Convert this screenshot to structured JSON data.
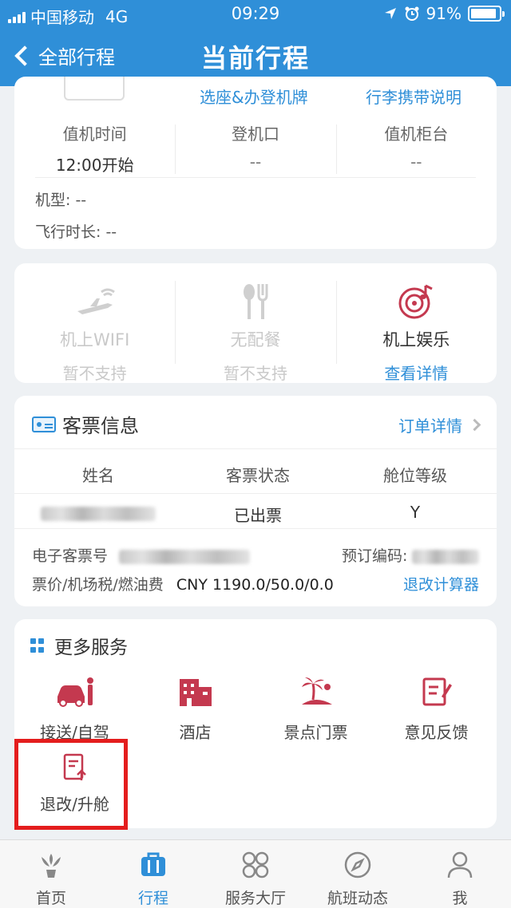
{
  "status_bar": {
    "carrier": "中国移动",
    "network": "4G",
    "time": "09:29",
    "battery_percent": "91%",
    "battery_level": 0.91
  },
  "nav": {
    "back_label": "全部行程",
    "title": "当前行程"
  },
  "flight_card": {
    "links": [
      "选座&办登机牌",
      "行李携带说明"
    ],
    "columns": [
      {
        "label": "值机时间",
        "value": "12:00开始"
      },
      {
        "label": "登机口",
        "value": "--"
      },
      {
        "label": "值机柜台",
        "value": "--"
      }
    ],
    "aircraft": "机型: --",
    "duration": "飞行时长: --"
  },
  "onboard": {
    "wifi": {
      "name": "机上WIFI",
      "status": "暂不支持"
    },
    "meal": {
      "name": "无配餐",
      "status": "暂不支持"
    },
    "entertainment": {
      "name": "机上娱乐",
      "status": "查看详情"
    }
  },
  "ticket": {
    "title": "客票信息",
    "order_link": "订单详情",
    "headers": [
      "姓名",
      "客票状态",
      "舱位等级"
    ],
    "status": "已出票",
    "cabin_class": "Y",
    "eticket_label": "电子客票号",
    "booking_label": "预订编码:",
    "fare_label": "票价/机场税/燃油费",
    "fare_value": "CNY 1190.0/50.0/0.0",
    "calculator_link": "退改计算器"
  },
  "more_services": {
    "title": "更多服务",
    "items": [
      "接送/自驾",
      "酒店",
      "景点门票",
      "意见反馈",
      "退改/升舱"
    ]
  },
  "tabs": [
    "首页",
    "行程",
    "服务大厅",
    "航班动态",
    "我"
  ],
  "colors": {
    "brand_blue": "#2f8fd8",
    "icon_red": "#c4394f",
    "highlight_red": "#e41d1d"
  }
}
